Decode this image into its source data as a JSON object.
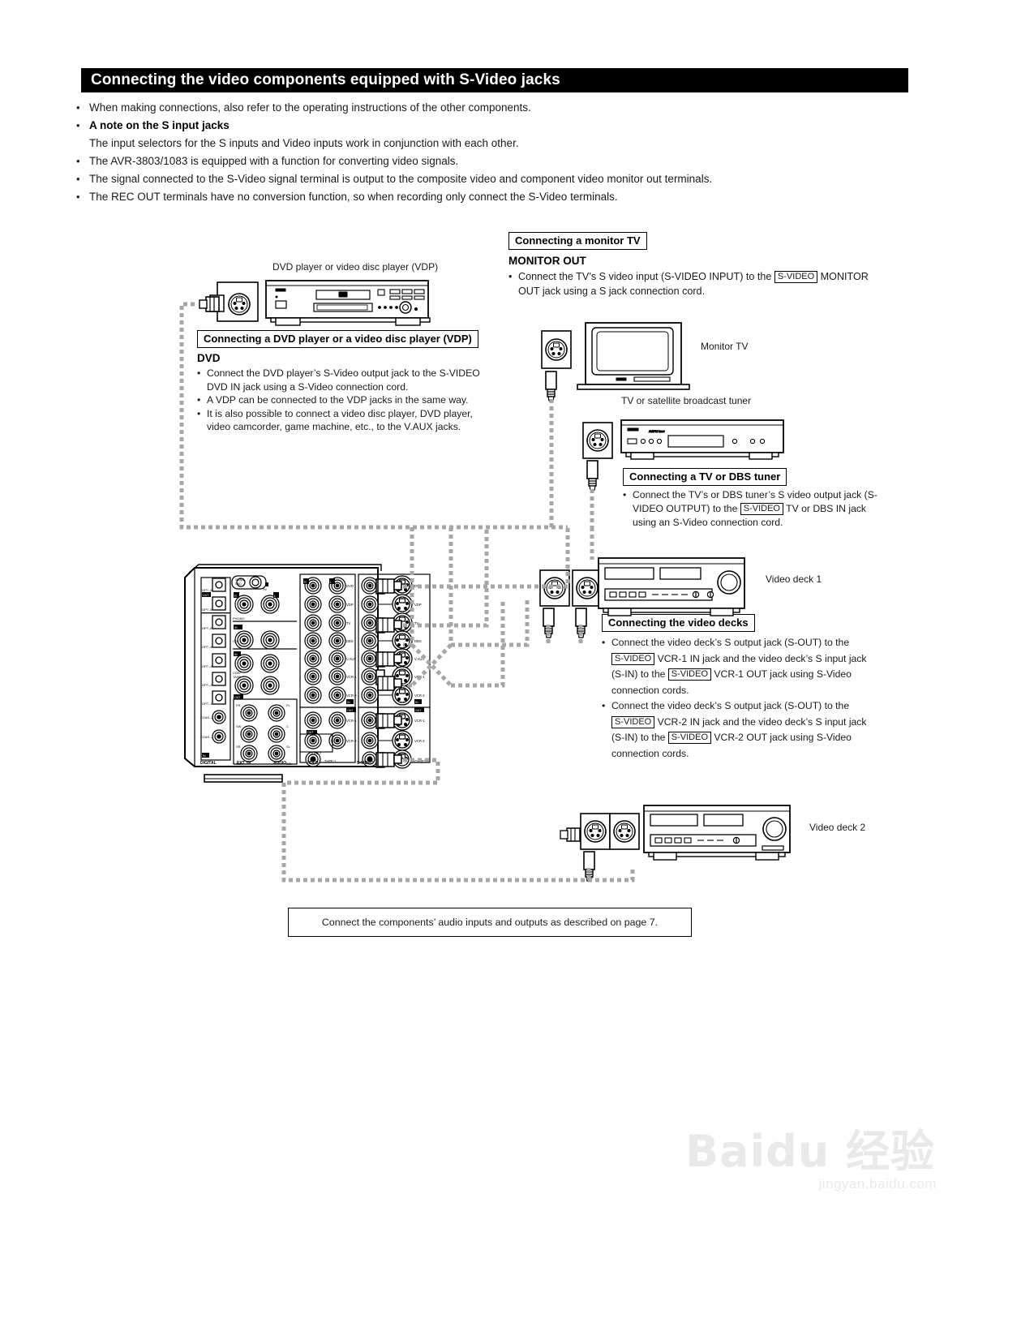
{
  "header": {
    "title": "Connecting the video components equipped with S-Video jacks"
  },
  "intro": {
    "bullets": [
      {
        "text": "When making connections, also refer to the operating instructions of the other components.",
        "bold": false,
        "bullet": true
      },
      {
        "text": "A note on the S input jacks",
        "bold": true,
        "bullet": true
      },
      {
        "text": "The input selectors for the S inputs and Video inputs work in conjunction with each other.",
        "bold": false,
        "bullet": false
      },
      {
        "text": "The AVR-3803/1083 is equipped with a function for converting video signals.",
        "bold": false,
        "bullet": true
      },
      {
        "text": "The signal connected to the S-Video signal terminal is output to the composite video and component video monitor out terminals.",
        "bold": false,
        "bullet": true
      },
      {
        "text": "The REC OUT terminals have no conversion function, so when recording only connect the S-Video terminals.",
        "bold": false,
        "bullet": true
      }
    ]
  },
  "monitor_tv": {
    "box_title": "Connecting a monitor TV",
    "subtitle": "MONITOR OUT",
    "line1_a": "Connect the TV’s S video input (S-VIDEO INPUT) to the",
    "chip": "S-VIDEO",
    "line1_b": "MONITOR",
    "line2": "OUT jack using a S jack connection cord."
  },
  "dvd": {
    "box_title": "Connecting a DVD player or a video disc player (VDP)",
    "subtitle": "DVD",
    "b1_a": "Connect the DVD player’s S-Video output jack to the S-VIDEO",
    "b1_b": "DVD IN jack using a S-Video connection cord.",
    "b2": "A VDP can be connected to the VDP jacks in the same way.",
    "b3_a": "It is also possible to connect a video disc player, DVD player,",
    "b3_b": "video camcorder, game machine, etc., to the V.AUX jacks."
  },
  "tuner": {
    "box_title": "Connecting a TV or DBS tuner",
    "line_a": "Connect the TV’s or DBS tuner’s S video output jack (S-",
    "line_b1": "VIDEO OUTPUT) to the",
    "chip": "S-VIDEO",
    "line_b2": "TV or DBS IN jack",
    "line_c": "using an S-Video connection cord."
  },
  "decks": {
    "box_title": "Connecting the video decks",
    "chip": "S-VIDEO",
    "b1_l1": "Connect the video deck’s S output jack (S-OUT) to the",
    "b1_l2a": "VCR-1 IN jack and the video deck’s S input jack",
    "b1_l3a": "(S-IN) to the",
    "b1_l3b": "VCR-1 OUT jack using S-Video",
    "b1_l4": "connection cords.",
    "b2_l1": "Connect the video deck’s S output jack (S-OUT) to the",
    "b2_l2a": "VCR-2 IN jack and the video deck’s S input jack",
    "b2_l3a": "(S-IN) to the",
    "b2_l3b": "VCR-2 OUT jack using S-Video",
    "b2_l4": "connection cords."
  },
  "captions": {
    "dvd_player": "DVD player or video disc player (VDP)",
    "monitor_tv": "Monitor TV",
    "tuner": "TV or satellite broadcast tuner",
    "video_deck_1": "Video deck 1",
    "video_deck_2": "Video deck 2"
  },
  "footnote": {
    "text": "Connect the components’ audio inputs and outputs as described on page 7."
  },
  "receiver": {
    "digital_labels": [
      "OPT.-6",
      "OPT.-5",
      "OPT.-4",
      "OPT.-3",
      "OPT.-2",
      "OPT.-1",
      "COAX.-2",
      "COAX.-1"
    ],
    "digital_badges": [
      "OUT",
      "IN",
      "IN"
    ],
    "signal_gnd": "SIGNAL GND",
    "audio_rows": [
      "PHONO",
      "CD",
      "CDR/TAPE"
    ],
    "audio_badges": [
      "IN",
      "OUT",
      "IN",
      "OUT"
    ],
    "extin_labels": [
      "FR",
      "FL",
      "SW",
      "C",
      "SR",
      "SL",
      "SBR",
      "SBL"
    ],
    "video_rows": [
      "DVD",
      "VDP",
      "TV",
      "DBS",
      "V.AUX",
      "VCR-1",
      "VCR-2",
      "VCR-1",
      "VCR-2",
      "MONITOR"
    ],
    "svideo_rows": [
      "DVD",
      "VDP",
      "TV",
      "DBS",
      "V.AUX",
      "VCR-1",
      "VCR-2",
      "VCR-1",
      "VCR-2",
      "MONITOR"
    ],
    "badges": [
      "IN",
      "OUT"
    ],
    "zone_label": "ZONE 2",
    "bottom_labels": [
      "DIGITAL",
      "EXT. IN",
      "AUDIO",
      "VIDEO",
      "S-VIDEO"
    ],
    "lr_labels": [
      "R",
      "L"
    ]
  },
  "watermark": {
    "main": "Baidu 经验",
    "sub": "jingyan.baidu.com"
  },
  "colors": {
    "ink": "#000000",
    "text": "#1a1a1a",
    "cable": "#a6a6a6"
  }
}
